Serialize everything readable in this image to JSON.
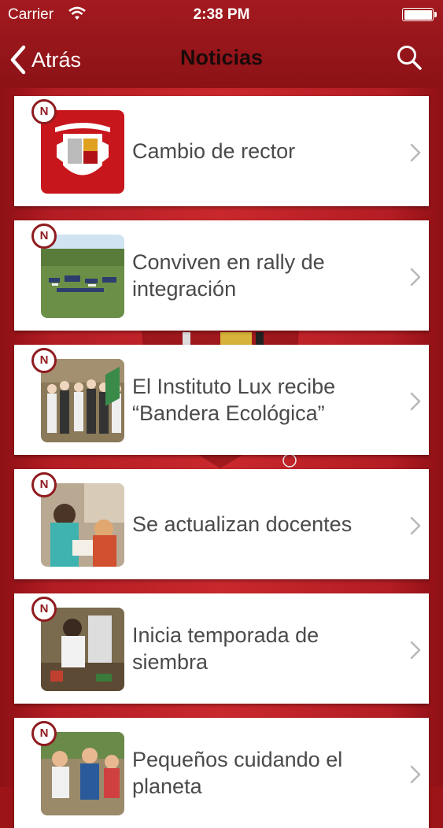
{
  "status": {
    "carrier": "Carrier",
    "time": "2:38 PM"
  },
  "nav": {
    "back_label": "Atrás",
    "title": "Noticias"
  },
  "news": [
    {
      "title": "Cambio de rector",
      "badge": "N",
      "thumb": "seal"
    },
    {
      "title": "Conviven en rally de integración",
      "badge": "N",
      "thumb": "field"
    },
    {
      "title": "El Instituto Lux recibe “Bandera Ecológica”",
      "badge": "N",
      "thumb": "group"
    },
    {
      "title": "Se actualizan docentes",
      "badge": "N",
      "thumb": "teachers"
    },
    {
      "title": "Inicia temporada de siembra",
      "badge": "N",
      "thumb": "planting"
    },
    {
      "title": "Pequeños cuidando el planeta",
      "badge": "N",
      "thumb": "kids"
    }
  ],
  "colors": {
    "brand_red": "#9c1418",
    "badge_red": "#8f1b1f",
    "card_bg": "#ffffff",
    "title_text": "#4a4a4a"
  }
}
